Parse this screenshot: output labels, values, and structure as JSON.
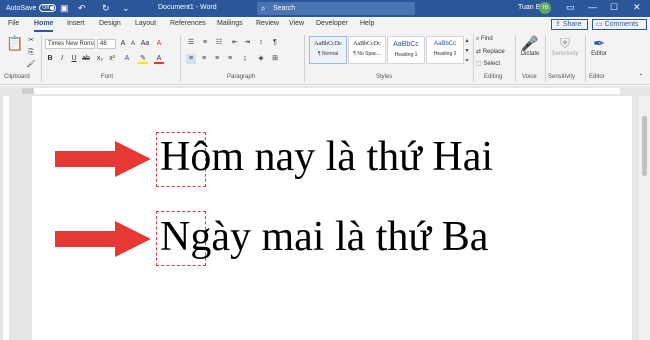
{
  "titlebar": {
    "autosave_label": "AutoSave",
    "autosave_state": "Off",
    "document_title": "Document1 - Word",
    "search_placeholder": "Search",
    "user_name": "Tuan Bui",
    "user_initials": "TB",
    "accent_color": "#2b579a"
  },
  "tabs": [
    "File",
    "Home",
    "Insert",
    "Design",
    "Layout",
    "References",
    "Mailings",
    "Review",
    "View",
    "Developer",
    "Help"
  ],
  "active_tab": "Home",
  "actions": {
    "share_label": "Share",
    "comments_label": "Comments"
  },
  "ribbon": {
    "groups": {
      "clipboard": "Clipboard",
      "font": "Font",
      "paragraph": "Paragraph",
      "styles": "Styles",
      "editing": "Editing",
      "voice": "Voice",
      "sensitivity": "Sensitivity",
      "editor": "Editor"
    },
    "font_name": "Times New Roman",
    "font_size": "48",
    "bold": "B",
    "italic": "I",
    "underline": "U",
    "styles": [
      {
        "preview": "AaBbCcDc",
        "name": "¶ Normal"
      },
      {
        "preview": "AaBbCcDc",
        "name": "¶ No Spac..."
      },
      {
        "preview": "AaBbCc",
        "name": "Heading 1"
      },
      {
        "preview": "AaBbCc",
        "name": "Heading 2"
      }
    ],
    "editing": {
      "find": "Find",
      "replace": "Replace",
      "select": "Select"
    },
    "dictate": "Dictate",
    "sensitivity": "Sensitivity",
    "editor": "Editor"
  },
  "document": {
    "line1": "Hôm nay là thứ Hai",
    "line2": "Ngày mai là thứ Ba",
    "annotation_color": "#e53935"
  }
}
